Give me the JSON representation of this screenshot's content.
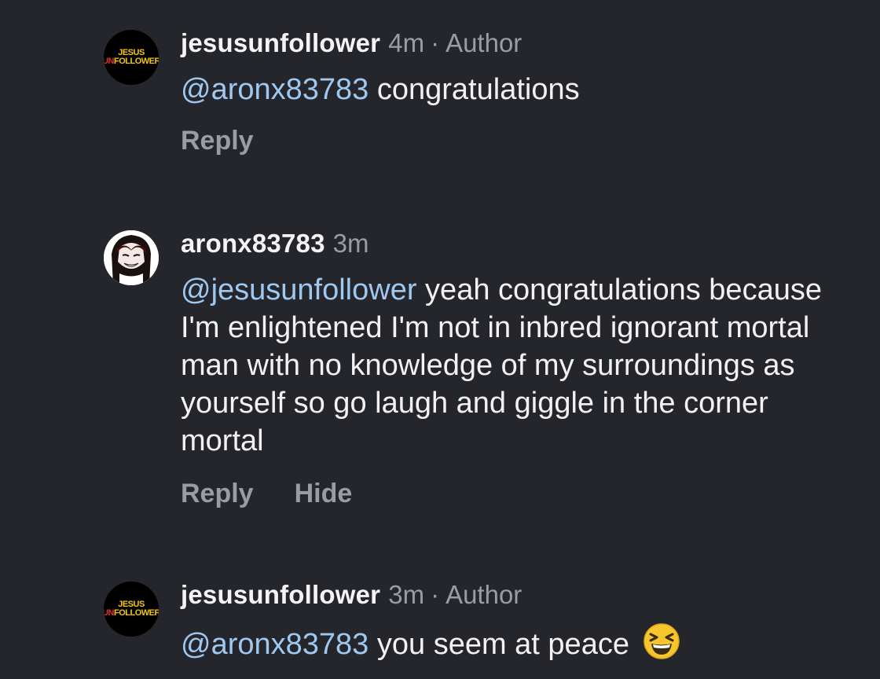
{
  "comments": [
    {
      "username": "jesusunfollower",
      "time": "4m",
      "role": "Author",
      "avatar": {
        "line1": "JESUS",
        "line2_red": "UN",
        "line2_rest": "FOLLOWER"
      },
      "mention": "@aronx83783",
      "text": " congratulations",
      "actions": [
        "Reply"
      ]
    },
    {
      "username": "aronx83783",
      "time": "3m",
      "avatar": {
        "icon": "anime-face-avatar"
      },
      "mention": "@jesusunfollower",
      "text": " yeah congratulations because I'm enlightened I'm not in inbred ignorant mortal man with no knowledge of my surroundings as yourself so go laugh and giggle in the corner mortal",
      "actions": [
        "Reply",
        "Hide"
      ]
    },
    {
      "username": "jesusunfollower",
      "time": "3m",
      "role": "Author",
      "avatar": {
        "line1": "JESUS",
        "line2_red": "UN",
        "line2_rest": "FOLLOWER"
      },
      "mention": "@aronx83783",
      "text": " you seem at peace",
      "emoji": "grinning-squinting-face-emoji"
    }
  ],
  "colors": {
    "background": "#24262c",
    "mention": "#9fc8f0",
    "muted": "#9a9ca3"
  }
}
